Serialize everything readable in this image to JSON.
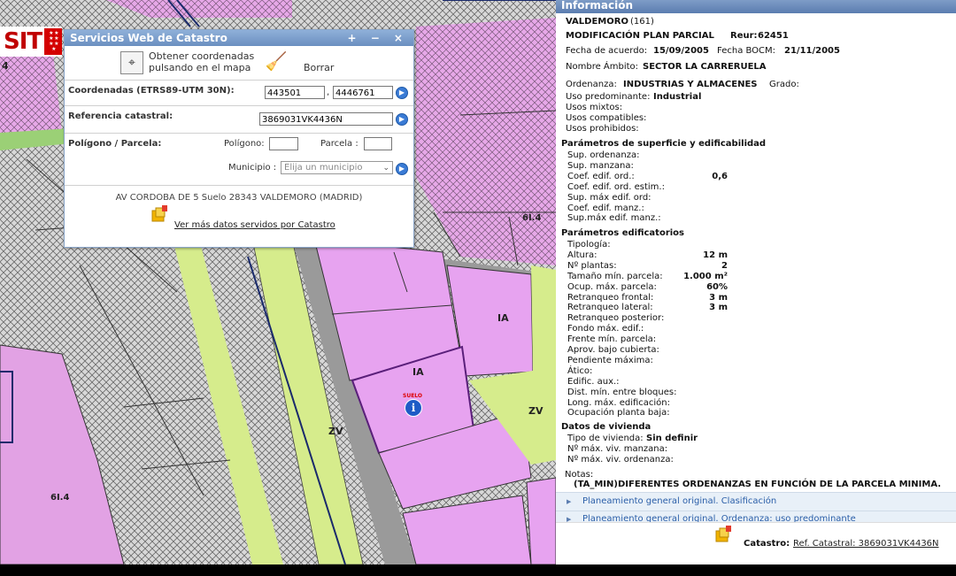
{
  "map": {
    "zone_labels": {
      "ia_top": "IA",
      "ia_center": "IA",
      "zv_left": "ZV",
      "zv_right": "ZV",
      "zone_61_4_top": "6I.4",
      "zone_61_4_bottom": "6I.4",
      "zone_4": "4"
    },
    "marker_label": "SUELO",
    "marker_glyph": "i",
    "logo_text": "SIT"
  },
  "catastro_dialog": {
    "title": "Servicios Web de Catastro",
    "title_controls": "+ − ×",
    "get_coords_label": "Obtener coordenadas pulsando en el mapa",
    "clear_label": "Borrar",
    "coords_label": "Coordenadas (ETRS89-UTM 30N):",
    "coord_x": "443501",
    "coord_separator": ",",
    "coord_y": "4446761",
    "cadastral_ref_label": "Referencia catastral:",
    "cadastral_ref_value": "3869031VK4436N",
    "polygon_parcel_label": "Polígono / Parcela:",
    "polygon_label": "Polígono:",
    "polygon_value": "",
    "parcel_label": "Parcela :",
    "parcel_value": "",
    "municipality_label": "Municipio :",
    "municipality_placeholder": "Elija un municipio",
    "address": "AV CORDOBA DE 5 Suelo 28343 VALDEMORO (MADRID)",
    "more_data_link": "Ver más datos servidos por Catastro"
  },
  "info_panel": {
    "title": "Información",
    "municipality": "VALDEMORO",
    "municipality_code": "(161)",
    "plan_type": "MODIFICACIÓN PLAN PARCIAL",
    "reur_label": "Reur:",
    "reur_value": "62451",
    "agreement_date_label": "Fecha de acuerdo:",
    "agreement_date": "15/09/2005",
    "bocm_date_label": "Fecha BOCM:",
    "bocm_date": "21/11/2005",
    "scope_name_label": "Nombre Ámbito:",
    "scope_name": "SECTOR LA CARRERUELA",
    "ordinance_label": "Ordenanza:",
    "ordinance": "INDUSTRIAS Y ALMACENES",
    "grade_label": "Grado:",
    "uses": {
      "predominant_label": "Uso predominante:",
      "predominant": "Industrial",
      "mixed_label": "Usos mixtos:",
      "compatible_label": "Usos compatibles:",
      "prohibited_label": "Usos prohibidos:"
    },
    "surface_section": "Parámetros de superficie y edificabilidad",
    "surface_params": [
      {
        "label": "Sup. ordenanza:",
        "value": ""
      },
      {
        "label": "Sup. manzana:",
        "value": ""
      },
      {
        "label": "Coef. edif. ord.:",
        "value": "0,6"
      },
      {
        "label": "Coef. edif. ord. estim.:",
        "value": ""
      },
      {
        "label": "Sup. máx edif. ord:",
        "value": ""
      },
      {
        "label": "Coef. edif. manz.:",
        "value": ""
      },
      {
        "label": "Sup.máx edif. manz.:",
        "value": ""
      }
    ],
    "building_section": "Parámetros edificatorios",
    "building_params": [
      {
        "label": "Tipología:",
        "value": ""
      },
      {
        "label": "Altura:",
        "value": "12 m"
      },
      {
        "label": "Nº plantas:",
        "value": "2"
      },
      {
        "label": "Tamaño mín. parcela:",
        "value": "1.000 m²"
      },
      {
        "label": "Ocup. máx. parcela:",
        "value": "60%"
      },
      {
        "label": "Retranqueo frontal:",
        "value": "3 m"
      },
      {
        "label": "Retranqueo lateral:",
        "value": "3 m"
      },
      {
        "label": "Retranqueo posterior:",
        "value": ""
      },
      {
        "label": "Fondo máx. edif.:",
        "value": ""
      },
      {
        "label": "Frente mín. parcela:",
        "value": ""
      },
      {
        "label": "Aprov. bajo cubierta:",
        "value": ""
      },
      {
        "label": "Pendiente máxima:",
        "value": ""
      },
      {
        "label": "Ático:",
        "value": ""
      },
      {
        "label": "Edific. aux.:",
        "value": ""
      },
      {
        "label": "Dist. mín. entre bloques:",
        "value": ""
      },
      {
        "label": "Long. máx. edificación:",
        "value": ""
      },
      {
        "label": "Ocupación planta baja:",
        "value": ""
      }
    ],
    "housing_section": "Datos de vivienda",
    "housing_type_label": "Tipo de vivienda:",
    "housing_type": "Sin definir",
    "max_dwellings_block_label": "Nº máx. viv. manzana:",
    "max_dwellings_ordinance_label": "Nº máx. viv. ordenanza:",
    "notes_label": "Notas:",
    "notes": "(TA_MIN)DIFERENTES ORDENANZAS EN FUNCIÓN DE LA PARCELA MINIMA.",
    "accordions": [
      "Planeamiento general original. Clasificación",
      "Planeamiento general original. Ordenanza: uso predominante"
    ],
    "catastro_label": "Catastro:",
    "catastro_ref_link": "Ref. Catastral: 3869031VK4436N"
  }
}
